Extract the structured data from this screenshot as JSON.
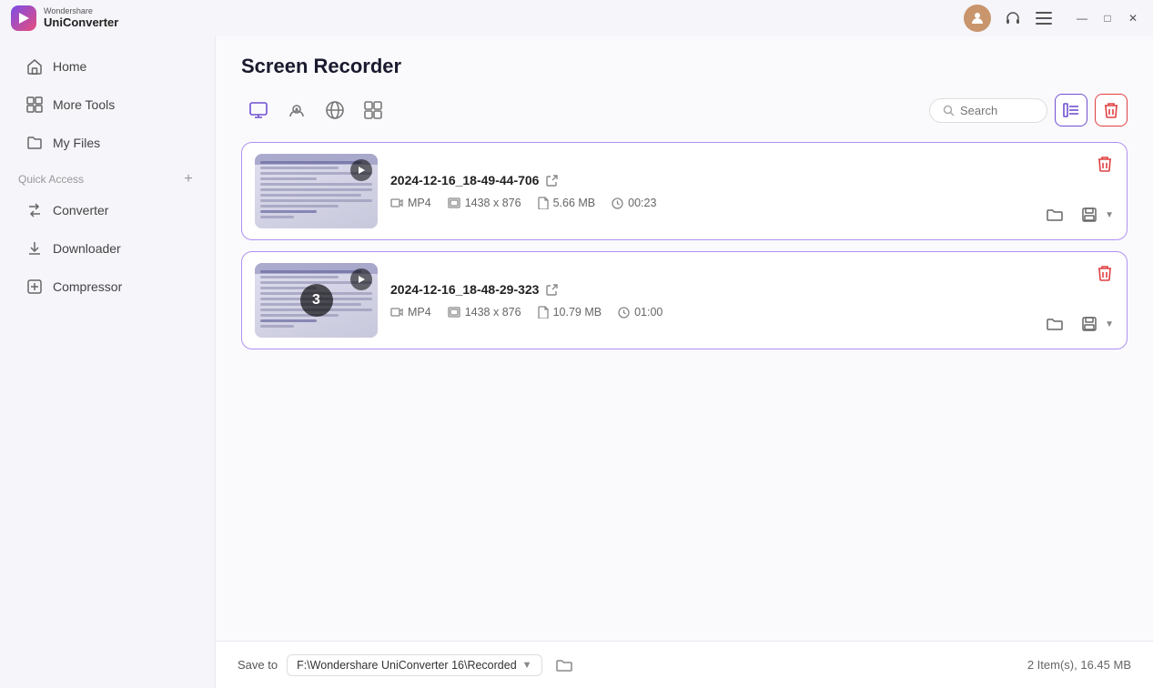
{
  "app": {
    "vendor": "Wondershare",
    "name": "UniConverter",
    "logo_symbol": "▶"
  },
  "titlebar": {
    "avatar_initial": "👤",
    "icons": {
      "headset": "🎧",
      "menu": "☰"
    },
    "window_controls": {
      "minimize": "—",
      "maximize": "□",
      "close": "✕"
    }
  },
  "sidebar": {
    "items": [
      {
        "id": "home",
        "label": "Home",
        "icon": "⌂"
      },
      {
        "id": "more-tools",
        "label": "More Tools",
        "icon": "🗂"
      },
      {
        "id": "my-files",
        "label": "My Files",
        "icon": "📁"
      }
    ],
    "quick_access_label": "Quick Access",
    "quick_access_items": [
      {
        "id": "converter",
        "label": "Converter",
        "icon": "🔄"
      },
      {
        "id": "downloader",
        "label": "Downloader",
        "icon": "⬇"
      },
      {
        "id": "compressor",
        "label": "Compressor",
        "icon": "📦"
      }
    ]
  },
  "page": {
    "title": "Screen Recorder"
  },
  "toolbar": {
    "tabs": [
      {
        "id": "screen",
        "icon": "screen",
        "active": true
      },
      {
        "id": "webcam",
        "icon": "webcam",
        "active": false
      },
      {
        "id": "audio",
        "icon": "audio",
        "active": false
      },
      {
        "id": "apps",
        "icon": "apps",
        "active": false
      }
    ],
    "search_placeholder": "Search",
    "list_view_label": "List View",
    "delete_all_label": "Delete All"
  },
  "recordings": [
    {
      "id": "rec1",
      "name": "2024-12-16_18-49-44-706",
      "format": "MP4",
      "resolution": "1438 x 876",
      "size": "5.66 MB",
      "duration": "00:23",
      "has_play": true,
      "count": null
    },
    {
      "id": "rec2",
      "name": "2024-12-16_18-48-29-323",
      "format": "MP4",
      "resolution": "1438 x 876",
      "size": "10.79 MB",
      "duration": "01:00",
      "has_play": true,
      "count": "3"
    }
  ],
  "bottom_bar": {
    "save_to_label": "Save to",
    "save_path": "F:\\Wondershare UniConverter 16\\Recorded",
    "item_count": "2 Item(s), 16.45 MB"
  }
}
